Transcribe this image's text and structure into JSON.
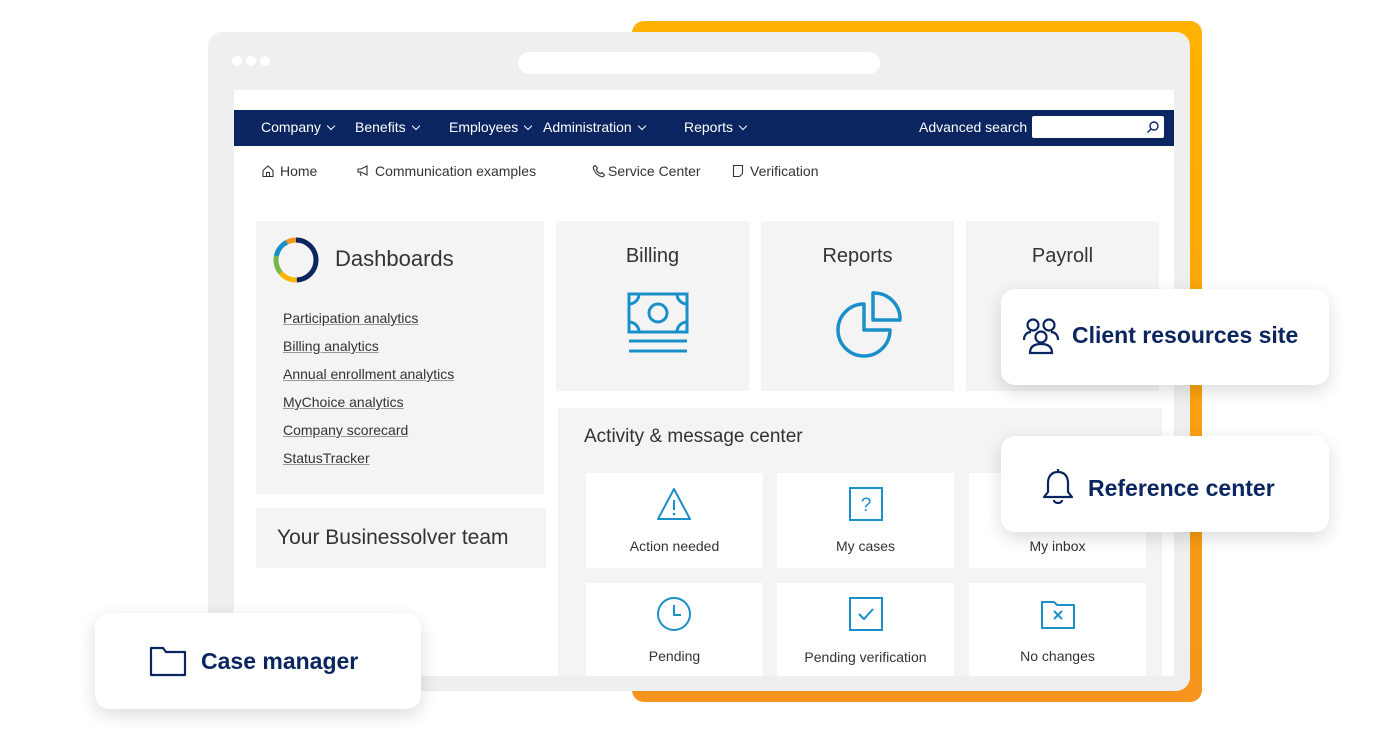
{
  "colors": {
    "navy": "#0b2560",
    "accent_blue": "#1a8fc9",
    "orange": "#f7941d",
    "panel_gray": "#f4f4f4"
  },
  "nav": {
    "items": [
      {
        "label": "Company",
        "icon": "chevron-down-icon"
      },
      {
        "label": "Benefits",
        "icon": "chevron-down-icon"
      },
      {
        "label": "Employees",
        "icon": "chevron-down-icon"
      },
      {
        "label": "Administration",
        "icon": "chevron-down-icon"
      },
      {
        "label": "Reports",
        "icon": "chevron-down-icon"
      }
    ],
    "advanced_search": "Advanced search",
    "search_value": "",
    "search_icon": "search-icon"
  },
  "quick_links": [
    {
      "label": "Home",
      "icon": "home-icon"
    },
    {
      "label": "Communication examples",
      "icon": "megaphone-icon"
    },
    {
      "label": "Service Center",
      "icon": "phone-icon"
    },
    {
      "label": "Verification",
      "icon": "document-icon"
    }
  ],
  "dashboards": {
    "title": "Dashboards",
    "icon": "donut-chart-icon",
    "links": [
      "Participation analytics",
      "Billing analytics",
      "Annual enrollment analytics",
      "MyChoice analytics",
      "Company scorecard",
      "StatusTracker"
    ]
  },
  "team": {
    "title": "Your Businessolver team"
  },
  "tiles": [
    {
      "title": "Billing",
      "icon": "money-icon"
    },
    {
      "title": "Reports",
      "icon": "pie-chart-icon"
    },
    {
      "title": "Payroll",
      "icon": ""
    }
  ],
  "activity": {
    "title": "Activity & message center",
    "cards": [
      {
        "label": "Action needed",
        "icon": "warning-icon"
      },
      {
        "label": "My cases",
        "icon": "question-icon"
      },
      {
        "label": "My inbox",
        "icon": "inbox-icon"
      },
      {
        "label": "Pending",
        "icon": "clock-icon"
      },
      {
        "label": "Pending verification",
        "icon": "check-box-icon"
      },
      {
        "label": "No changes",
        "icon": "folder-x-icon"
      }
    ]
  },
  "floating": {
    "client_resources": {
      "label": "Client resources site",
      "icon": "people-icon"
    },
    "reference_center": {
      "label": "Reference center",
      "icon": "bell-icon"
    },
    "case_manager": {
      "label": "Case manager",
      "icon": "folder-icon"
    }
  }
}
